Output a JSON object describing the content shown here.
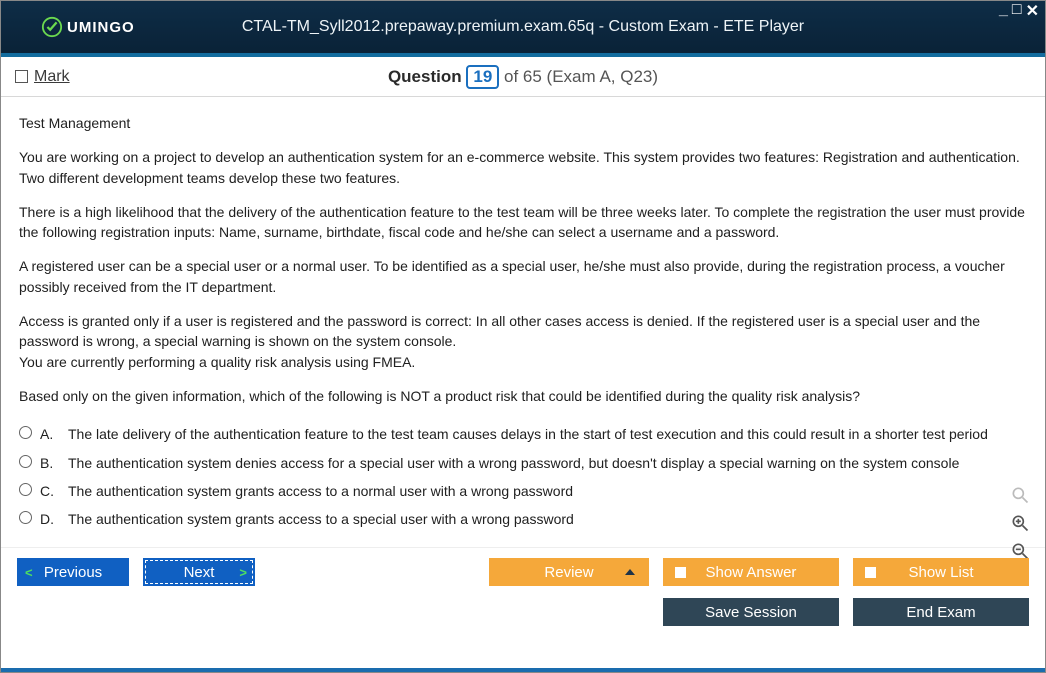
{
  "window": {
    "logo_text": "UMINGO",
    "title": "CTAL-TM_Syll2012.prepaway.premium.exam.65q - Custom Exam - ETE Player"
  },
  "header": {
    "mark_label": "Mark",
    "question_word": "Question",
    "current": "19",
    "total_suffix": "of 65 (Exam A, Q23)"
  },
  "body": {
    "topic": "Test Management",
    "p1": "You are working on a project to develop an authentication system for an e-commerce website. This system provides two features: Registration and authentication. Two different development teams develop these two features.",
    "p2": "There is a high likelihood that the delivery of the authentication feature to the test team will be three weeks later. To complete the registration the user must provide the following registration inputs: Name, surname, birthdate, fiscal code and he/she can select a username and a password.",
    "p3": "A registered user can be a special user or a normal user. To be identified as a special user, he/she must also provide, during the registration process, a voucher possibly received from the IT department.",
    "p4a": "Access is granted only if a user is registered and the password is correct: In all other cases access is denied. If the registered user is a special user and the password is wrong,  a special warning is shown on the system console.",
    "p4b": "You are currently performing a quality risk analysis using FMEA.",
    "p5": "Based only on the given information, which of the following is NOT a product risk that could be identified during the quality risk analysis?",
    "options": [
      {
        "letter": "A.",
        "text": "The late delivery of the authentication feature to the test team causes delays in the start of test execution and this could result in a shorter test period"
      },
      {
        "letter": "B.",
        "text": "The authentication system denies access for a special user with a wrong password, but doesn't display a special warning on the system console"
      },
      {
        "letter": "C.",
        "text": "The authentication system grants access to a normal user with a wrong password"
      },
      {
        "letter": "D.",
        "text": "The authentication system grants access to a special user with a wrong password"
      }
    ]
  },
  "buttons": {
    "previous": "Previous",
    "next": "Next",
    "review": "Review",
    "show_answer": "Show Answer",
    "show_list": "Show List",
    "save_session": "Save Session",
    "end_exam": "End Exam"
  }
}
